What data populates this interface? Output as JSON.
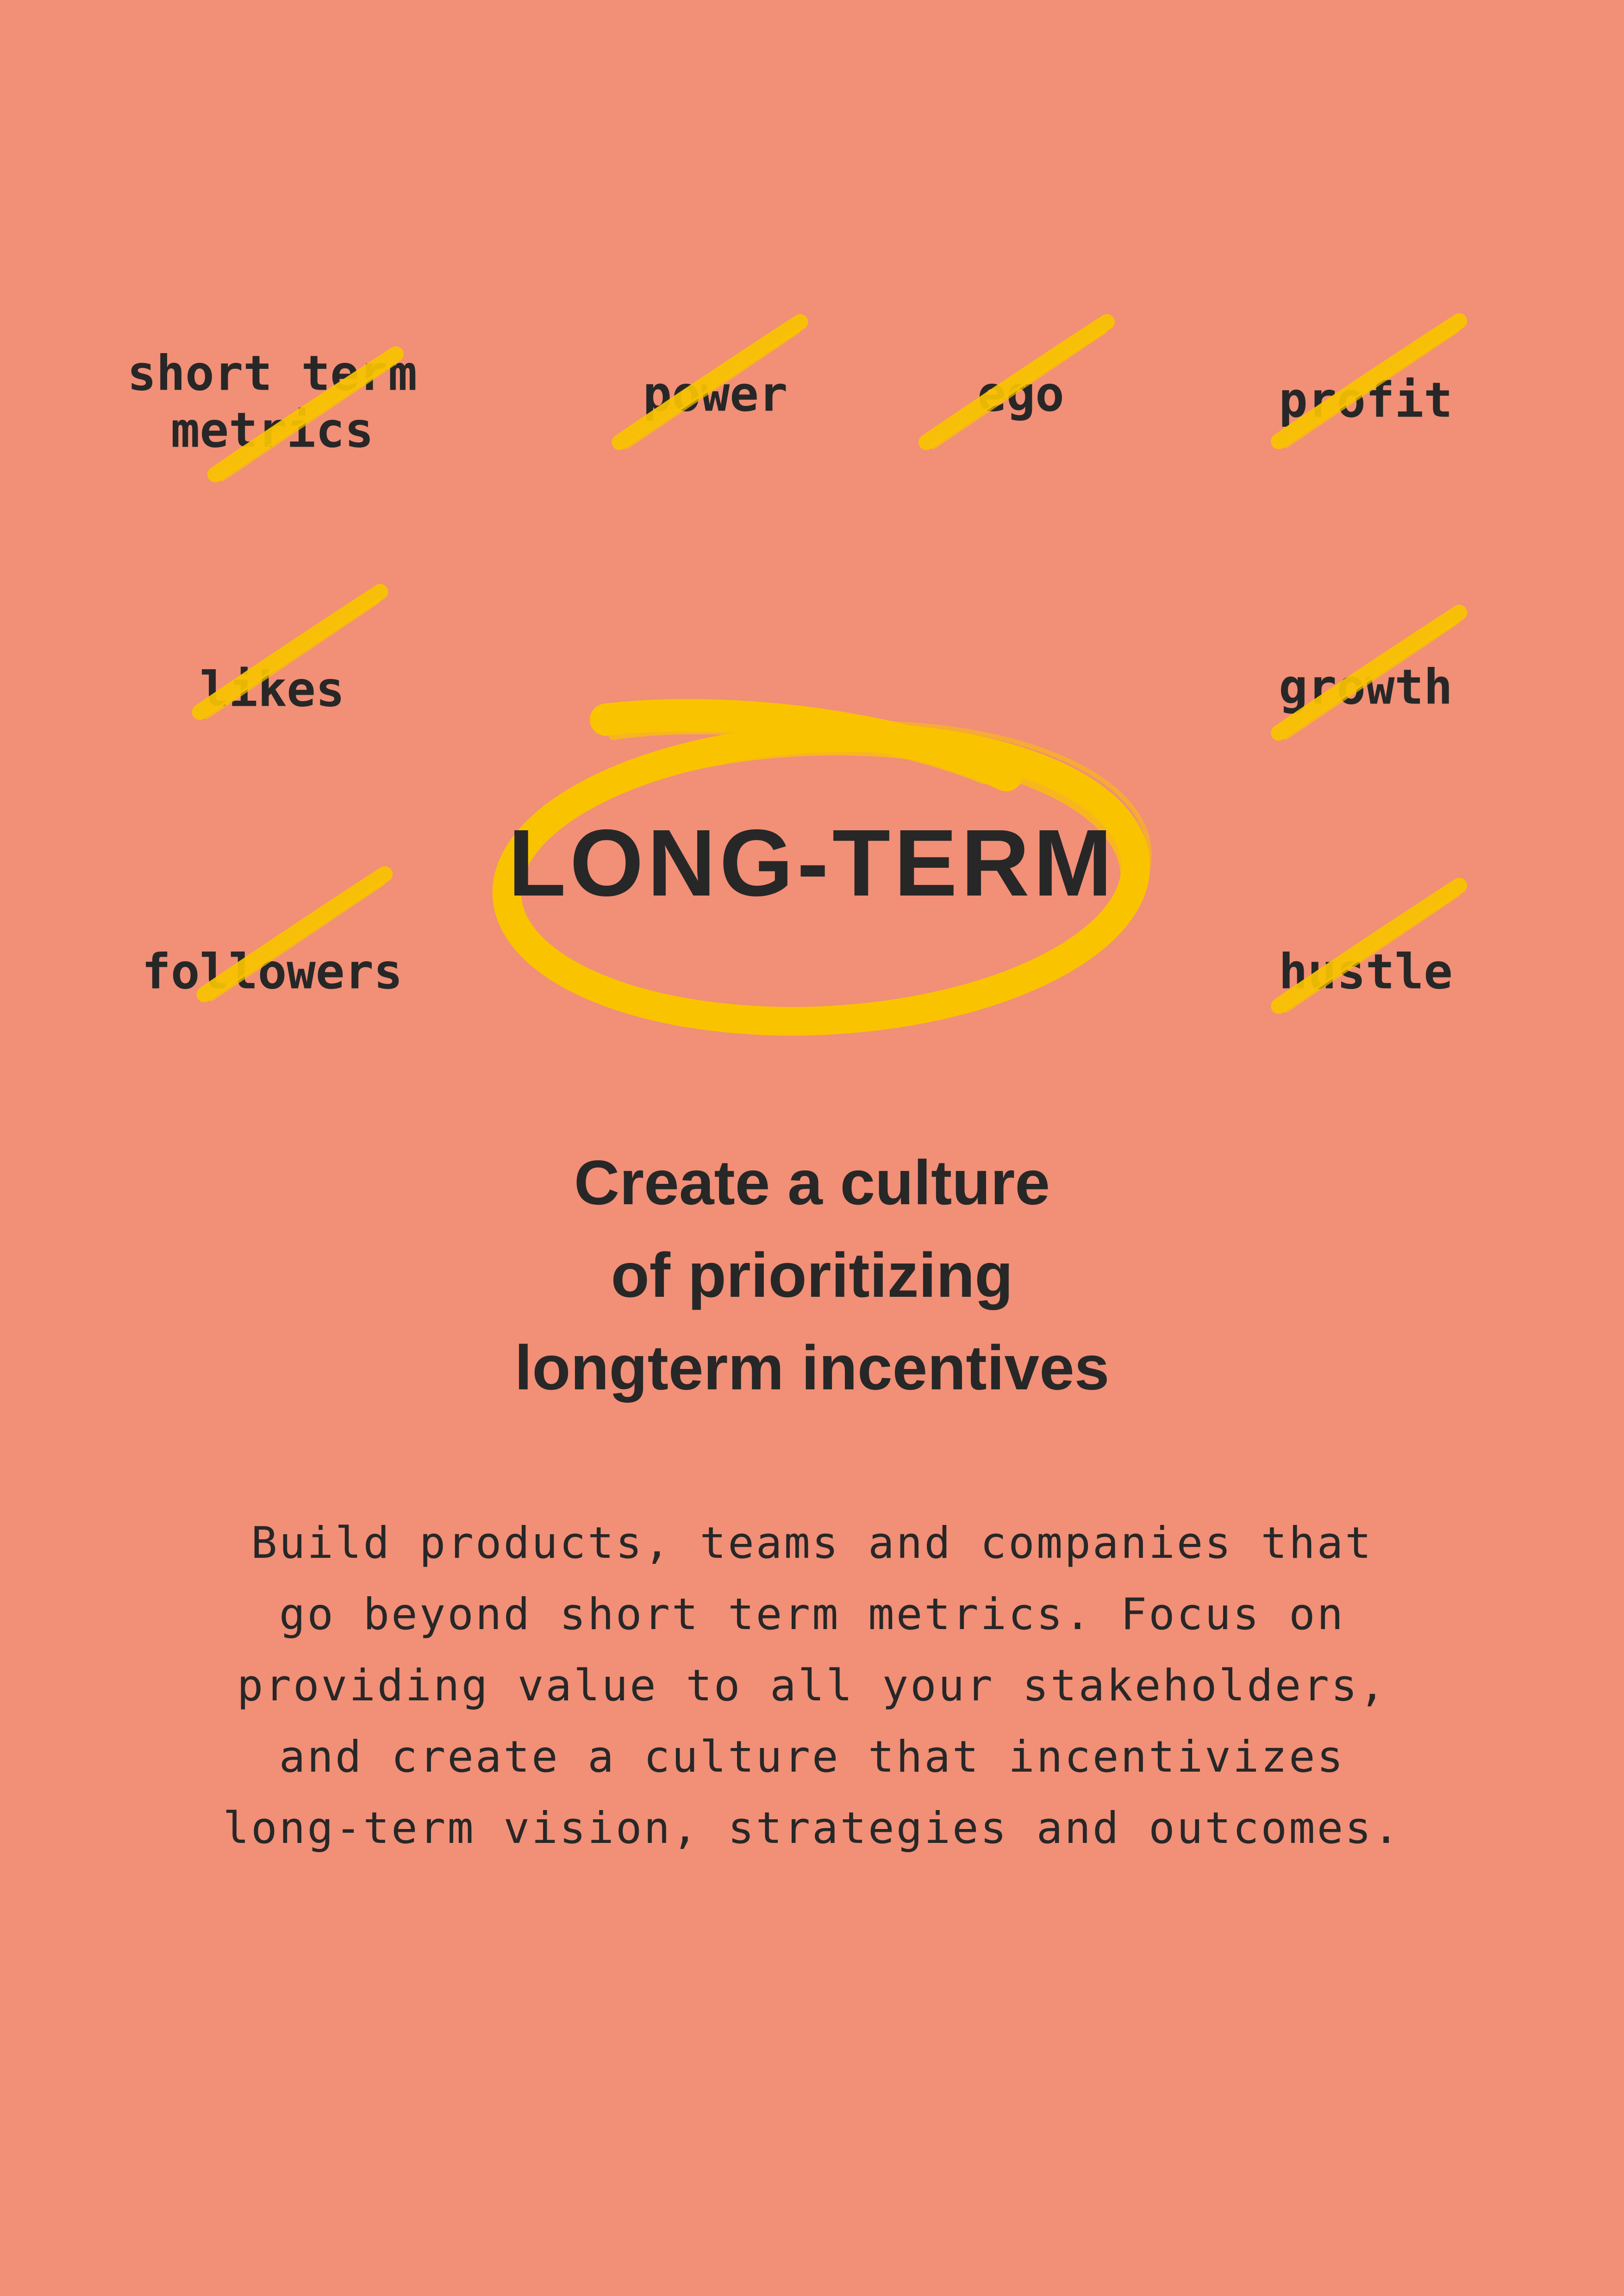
{
  "colors": {
    "background": "#F18F77",
    "highlight": "#F9C300",
    "text": "#272727"
  },
  "crossed_out_words": [
    {
      "lines": [
        "short term",
        "metrics"
      ]
    },
    {
      "lines": [
        "power"
      ]
    },
    {
      "lines": [
        "ego"
      ]
    },
    {
      "lines": [
        "profit"
      ]
    },
    {
      "lines": [
        "likes"
      ]
    },
    {
      "lines": [
        "growth"
      ]
    },
    {
      "lines": [
        "followers"
      ]
    },
    {
      "lines": [
        "hustle"
      ]
    }
  ],
  "center_word": "LONG-TERM",
  "headline": {
    "lines": [
      "Create a culture",
      "of prioritizing",
      "longterm incentives"
    ]
  },
  "body": {
    "lines": [
      "Build products, teams and companies that",
      "go beyond short term metrics. Focus on",
      "providing value to all your stakeholders,",
      "and create a culture that incentivizes",
      "long-term vision, strategies and outcomes."
    ]
  }
}
